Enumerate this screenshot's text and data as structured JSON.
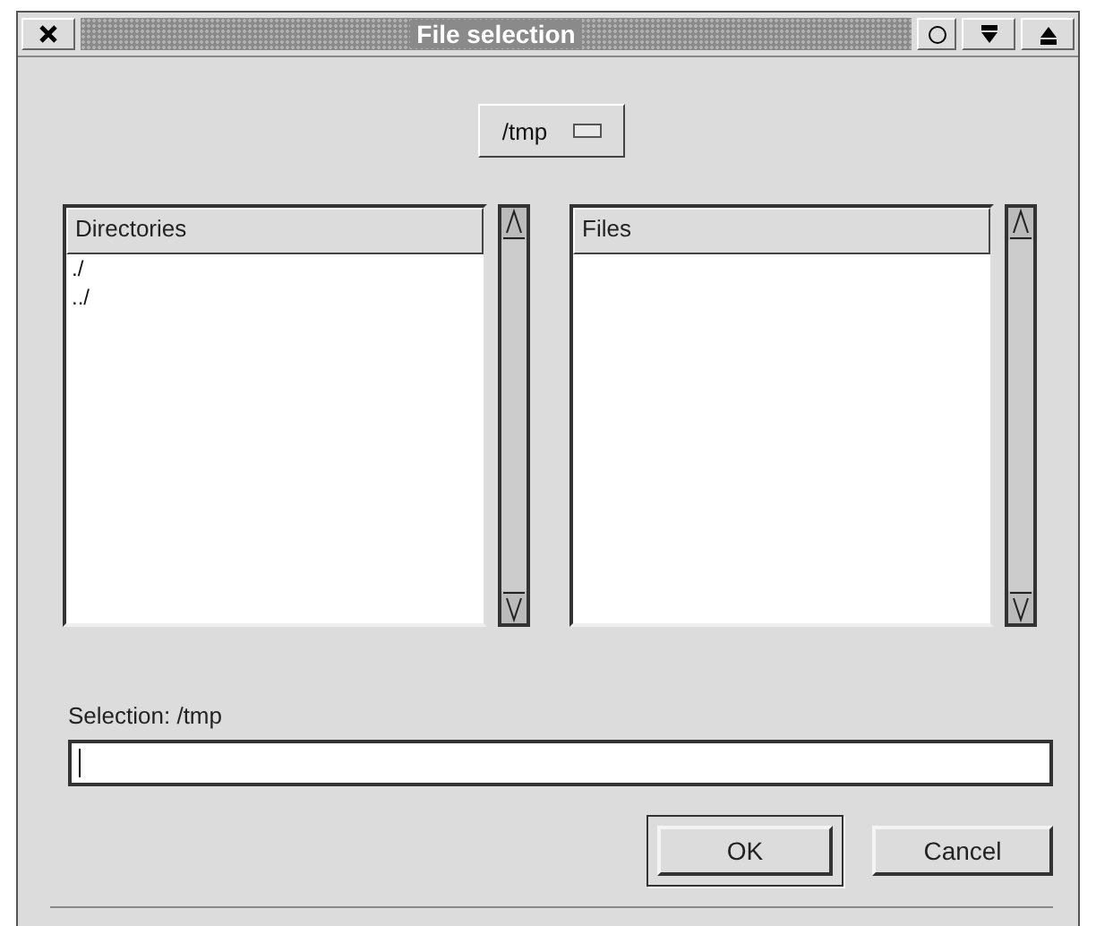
{
  "window": {
    "title": "File selection"
  },
  "path_menu": {
    "value": "/tmp"
  },
  "directories": {
    "heading": "Directories",
    "items": [
      "./",
      "../"
    ]
  },
  "files": {
    "heading": "Files"
  },
  "selection": {
    "label": "Selection: /tmp",
    "focused": true
  },
  "buttons": [
    {
      "label": "OK",
      "default": true
    },
    {
      "label": "Cancel",
      "default": false
    }
  ]
}
